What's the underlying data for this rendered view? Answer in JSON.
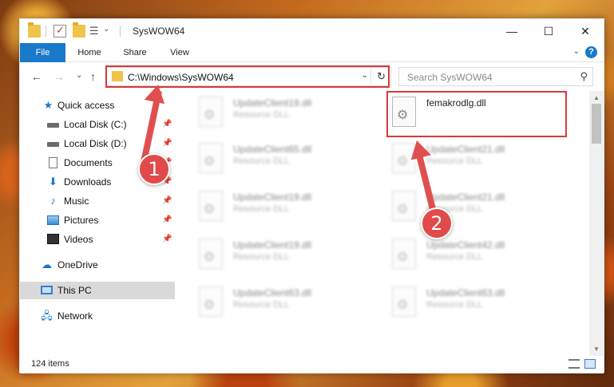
{
  "window": {
    "title": "SysWOW64",
    "controls": {
      "minimize": "—",
      "maximize": "☐",
      "close": "✕"
    }
  },
  "ribbon": {
    "tabs": [
      "File",
      "Home",
      "Share",
      "View"
    ],
    "help": "?",
    "collapse": "⌄"
  },
  "address": {
    "path": "C:\\Windows\\SysWOW64",
    "dropdown": "⌄",
    "refresh": "↻"
  },
  "navigation": {
    "back": "←",
    "forward": "→",
    "recent": "⌄",
    "up": "↑"
  },
  "search": {
    "placeholder": "Search SysWOW64",
    "icon": "⚲"
  },
  "sidebar": {
    "items": [
      {
        "label": "Quick access",
        "icon": "star-icon"
      },
      {
        "label": "Local Disk (C:)",
        "icon": "drive-icon",
        "pinned": "📌"
      },
      {
        "label": "Local Disk (D:)",
        "icon": "drive-icon",
        "pinned": "📌"
      },
      {
        "label": "Documents",
        "icon": "document-icon",
        "pinned": "📌"
      },
      {
        "label": "Downloads",
        "icon": "download-icon",
        "pinned": "📌"
      },
      {
        "label": "Music",
        "icon": "music-icon",
        "pinned": "📌"
      },
      {
        "label": "Pictures",
        "icon": "pictures-icon",
        "pinned": "📌"
      },
      {
        "label": "Videos",
        "icon": "videos-icon",
        "pinned": "📌"
      },
      {
        "label": "OneDrive",
        "icon": "cloud-icon"
      },
      {
        "label": "This PC",
        "icon": "computer-icon",
        "selected": true
      },
      {
        "label": "Network",
        "icon": "network-icon"
      }
    ]
  },
  "files": [
    {
      "name": "UpdateClient19.dll",
      "type": "Resource DLL"
    },
    {
      "name": "femakrodlg.dll",
      "type": ""
    },
    {
      "name": "UpdateClient65.dll",
      "type": "Resource DLL"
    },
    {
      "name": "UpdateClient21.dll",
      "type": "Resource DLL"
    },
    {
      "name": "UpdateClient19.dll",
      "type": "Resource DLL"
    },
    {
      "name": "UpdateClient21.dll",
      "type": "Resource DLL"
    },
    {
      "name": "UpdateClient19.dll",
      "type": "Resource DLL"
    },
    {
      "name": "UpdateClient42.dll",
      "type": "Resource DLL"
    },
    {
      "name": "UpdateClient63.dll",
      "type": "Resource DLL"
    },
    {
      "name": "UpdateClient63.dll",
      "type": "Resource DLL"
    }
  ],
  "status": {
    "item_count": "124 items"
  },
  "callouts": [
    "1",
    "2"
  ],
  "colors": {
    "accent": "#1979ca",
    "highlight": "#d63a3a"
  }
}
